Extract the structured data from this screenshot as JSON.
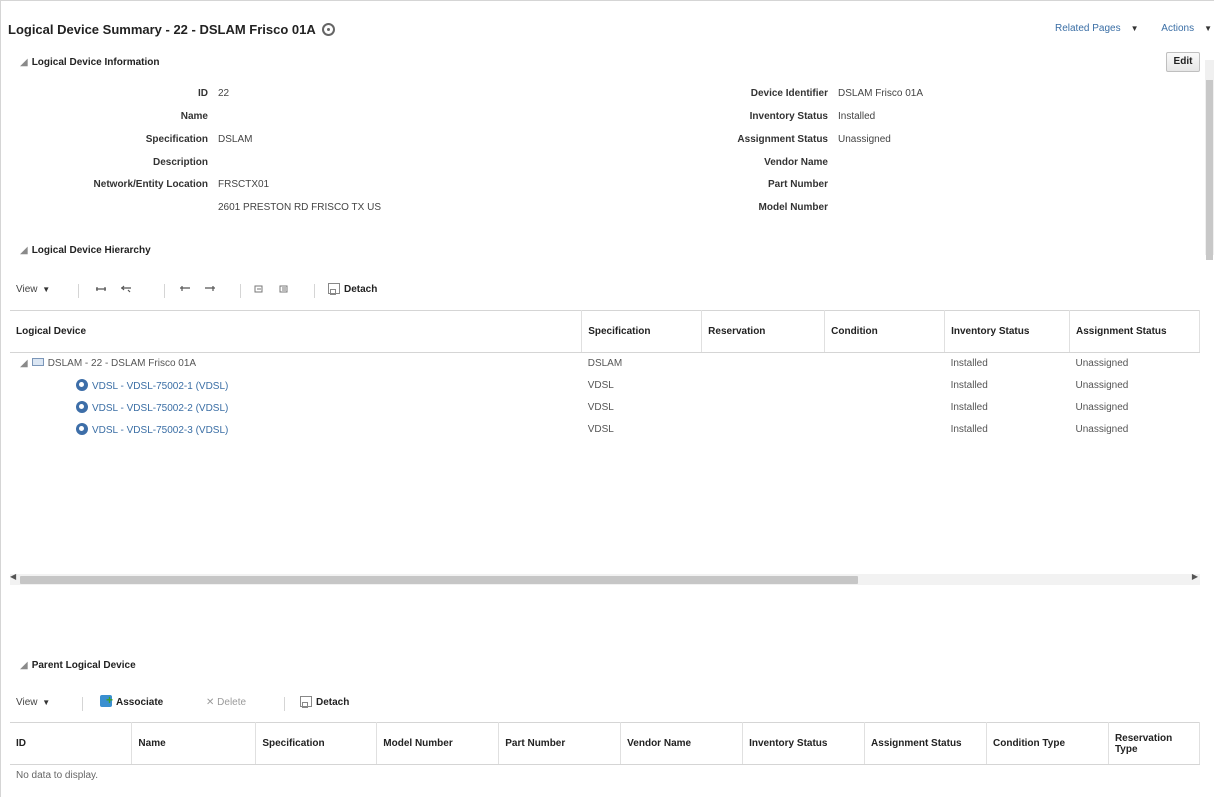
{
  "header": {
    "title": "Logical Device Summary - 22 - DSLAM Frisco 01A",
    "related_pages": "Related Pages",
    "actions": "Actions",
    "edit": "Edit"
  },
  "info": {
    "section_title": "Logical Device Information",
    "left": [
      {
        "label": "ID",
        "value": "22"
      },
      {
        "label": "Name",
        "value": ""
      },
      {
        "label": "Specification",
        "value": "DSLAM"
      },
      {
        "label": "Description",
        "value": ""
      },
      {
        "label": "Network/Entity Location",
        "value": "FRSCTX01"
      },
      {
        "label": "",
        "value": "2601 PRESTON RD FRISCO TX US"
      }
    ],
    "right": [
      {
        "label": "Device Identifier",
        "value": "DSLAM Frisco 01A"
      },
      {
        "label": "Inventory Status",
        "value": "Installed"
      },
      {
        "label": "Assignment Status",
        "value": "Unassigned"
      },
      {
        "label": "Vendor Name",
        "value": ""
      },
      {
        "label": "Part Number",
        "value": ""
      },
      {
        "label": "Model Number",
        "value": ""
      }
    ]
  },
  "hierarchy": {
    "section_title": "Logical Device Hierarchy",
    "toolbar": {
      "view": "View",
      "detach": "Detach"
    },
    "columns": [
      "Logical Device",
      "Specification",
      "Reservation",
      "Condition",
      "Inventory Status",
      "Assignment Status"
    ],
    "rows": [
      {
        "device": "DSLAM - 22 - DSLAM Frisco 01A",
        "spec": "DSLAM",
        "reservation": "",
        "condition": "",
        "inventory": "Installed",
        "assignment": "Unassigned"
      },
      {
        "device": "VDSL - VDSL-75002-1 (VDSL)",
        "spec": "VDSL",
        "reservation": "",
        "condition": "",
        "inventory": "Installed",
        "assignment": "Unassigned"
      },
      {
        "device": "VDSL - VDSL-75002-2 (VDSL)",
        "spec": "VDSL",
        "reservation": "",
        "condition": "",
        "inventory": "Installed",
        "assignment": "Unassigned"
      },
      {
        "device": "VDSL - VDSL-75002-3 (VDSL)",
        "spec": "VDSL",
        "reservation": "",
        "condition": "",
        "inventory": "Installed",
        "assignment": "Unassigned"
      }
    ]
  },
  "parent": {
    "section_title": "Parent Logical Device",
    "toolbar": {
      "view": "View",
      "associate": "Associate",
      "delete": "Delete",
      "detach": "Detach"
    },
    "columns": [
      "ID",
      "Name",
      "Specification",
      "Model Number",
      "Part Number",
      "Vendor Name",
      "Inventory Status",
      "Assignment Status",
      "Condition Type",
      "Reservation Type"
    ],
    "empty_text": "No data to display."
  }
}
